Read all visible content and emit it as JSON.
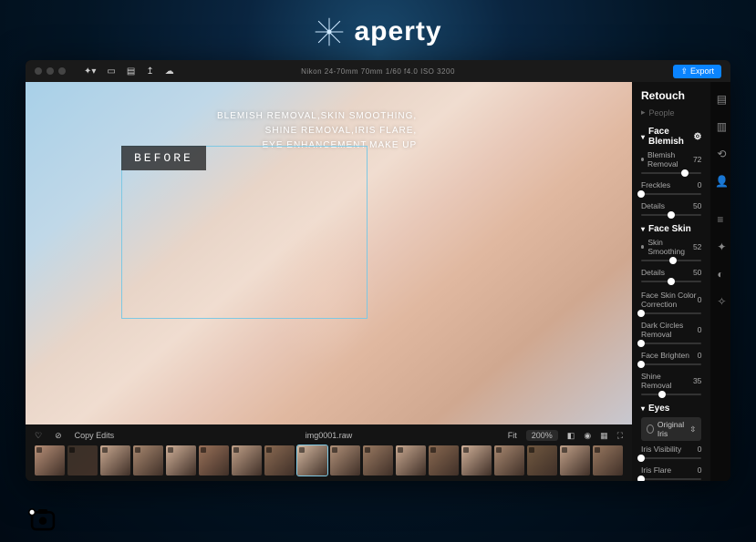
{
  "brand": {
    "name": "aperty"
  },
  "topbar": {
    "camera_meta": "Nikon 24-70mm  70mm  1/60  f4.0  ISO 3200",
    "export_label": "Export"
  },
  "canvas": {
    "overlay_line1": "BLEMISH REMOVAL,SKIN SMOOTHING,",
    "overlay_line2": "SHINE REMOVAL,IRIS FLARE,",
    "overlay_line3": "EYE ENHANCEMENT,MAKE UP",
    "before_label": "BEFORE"
  },
  "filmbar": {
    "copy_edits": "Copy Edits",
    "filename": "img0001.raw",
    "fit_label": "Fit",
    "zoom": "200%",
    "thumb_count": 18,
    "selected_index": 8
  },
  "retouch": {
    "title": "Retouch",
    "people_label": "People",
    "sections": {
      "faceBlemish": {
        "title": "Face Blemish",
        "controls": [
          {
            "label": "Blemish Removal",
            "value": 72,
            "pos": 72
          },
          {
            "label": "Freckles",
            "value": 0,
            "pos": 0
          },
          {
            "label": "Details",
            "value": 50,
            "pos": 50
          }
        ]
      },
      "faceSkin": {
        "title": "Face Skin",
        "controls": [
          {
            "label": "Skin Smoothing",
            "value": 52,
            "pos": 52
          },
          {
            "label": "Details",
            "value": 50,
            "pos": 50
          }
        ],
        "extras": [
          {
            "label": "Face Skin Color Correction",
            "value": 0,
            "pos": 0
          },
          {
            "label": "Dark Circles Removal",
            "value": 0,
            "pos": 0
          },
          {
            "label": "Face Brighten",
            "value": 0,
            "pos": 0
          },
          {
            "label": "Shine Removal",
            "value": 35,
            "pos": 35
          }
        ]
      },
      "eyes": {
        "title": "Eyes",
        "select_label": "Original Iris",
        "controls": [
          {
            "label": "Iris Visibility",
            "value": 0,
            "pos": 0
          },
          {
            "label": "Iris Flare",
            "value": 0,
            "pos": 0
          }
        ]
      }
    }
  }
}
